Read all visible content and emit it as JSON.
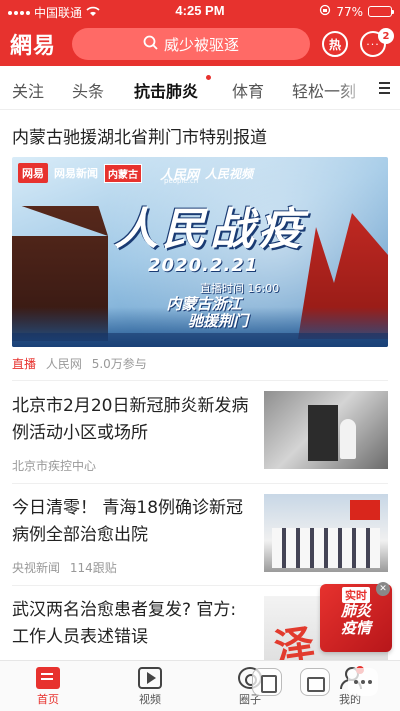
{
  "status_bar": {
    "carrier": "中国联通",
    "time": "4:25 PM",
    "battery_percent": "77%",
    "battery_level": 0.77
  },
  "header": {
    "logo": "網易",
    "search_placeholder": "威少被驱逐",
    "hot_label": "热",
    "message_badge": "2"
  },
  "tabs": [
    {
      "label": "关注"
    },
    {
      "label": "头条"
    },
    {
      "label": "抗击肺炎"
    },
    {
      "label": "体育"
    },
    {
      "label": "轻松一刻"
    }
  ],
  "active_tab": "抗击肺炎",
  "feed": {
    "top_story": {
      "title": "内蒙古驰援湖北省荆门市特别报道",
      "banner": {
        "brand": "网易新闻",
        "brand_icon": "网易",
        "region": "内蒙古",
        "partner1": "人民网",
        "partner1_url": "people.cn",
        "partner2": "人民视频",
        "headline": "人民战疫",
        "date": "2020.2.21",
        "live_time": "直播时间 16:00",
        "route_line1": "内蒙古浙江",
        "route_line2": "驰援荆门"
      },
      "live_tag": "直播",
      "source": "人民网",
      "participants": "5.0万参与"
    },
    "items": [
      {
        "title": "北京市2月20日新冠肺炎新发病例活动小区或场所",
        "source": "北京市疾控中心",
        "count": ""
      },
      {
        "title": "今日清零！ 青海18例确诊新冠病例全部治愈出院",
        "source": "央视新闻",
        "count": "114跟贴"
      },
      {
        "title": "武汉两名治愈患者复发? 官方: 工作人员表述错误",
        "source": "",
        "count": ""
      }
    ],
    "epidemic_badge": {
      "line1": "实时",
      "line2": "肺炎",
      "line3": "疫情"
    }
  },
  "bottom_nav": [
    {
      "label": "首页",
      "icon": "home-icon"
    },
    {
      "label": "视频",
      "icon": "play-icon"
    },
    {
      "label": "圈子",
      "icon": "circle-icon"
    },
    {
      "label": "我的",
      "icon": "user-icon"
    }
  ],
  "colors": {
    "brand_red": "#e7322e"
  }
}
